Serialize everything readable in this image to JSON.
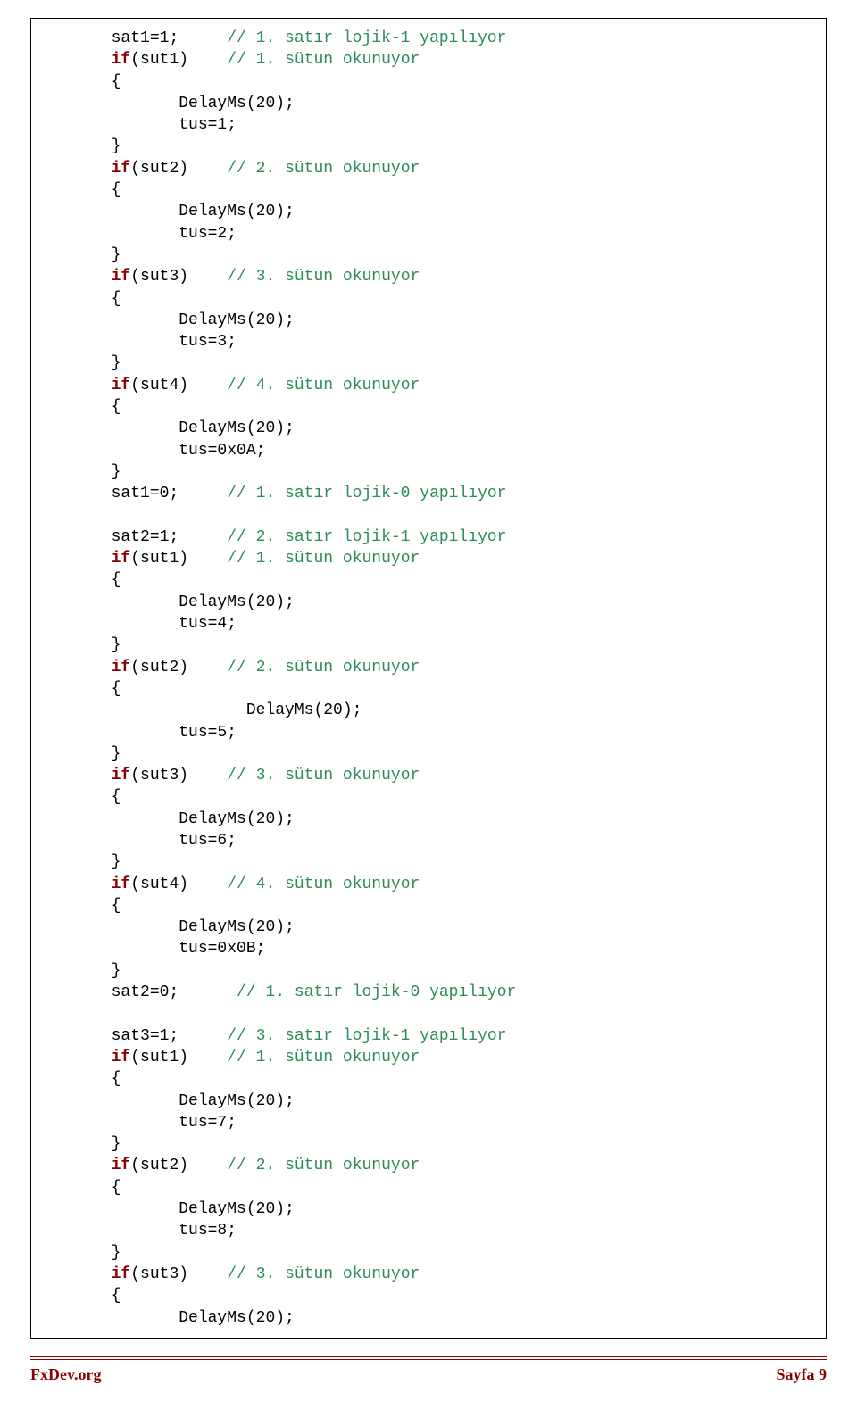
{
  "footer": {
    "site": "FxDev.org",
    "page": "Sayfa 9"
  },
  "c": {
    "l1a": "       sat1=1;     ",
    "l1b": "// 1. satır lojik-1 yapılıyor",
    "l2a": "       ",
    "l2if": "if",
    "l2b": "(sut1)    ",
    "l2c": "// 1. sütun okunuyor",
    "l3": "       {",
    "l4": "              DelayMs(20);",
    "l5": "              tus=1;",
    "l6": "       }",
    "l7a": "       ",
    "l7if": "if",
    "l7b": "(sut2)    ",
    "l7c": "// 2. sütun okunuyor",
    "l8": "       {",
    "l9": "              DelayMs(20);",
    "l10": "              tus=2;",
    "l11": "       }",
    "l12a": "       ",
    "l12if": "if",
    "l12b": "(sut3)    ",
    "l12c": "// 3. sütun okunuyor",
    "l13": "       {",
    "l14": "              DelayMs(20);",
    "l15": "              tus=3;",
    "l16": "       }",
    "l17a": "       ",
    "l17if": "if",
    "l17b": "(sut4)    ",
    "l17c": "// 4. sütun okunuyor",
    "l18": "       {",
    "l19": "              DelayMs(20);",
    "l20": "              tus=0x0A;",
    "l21": "       }",
    "l22a": "       sat1=0;     ",
    "l22b": "// 1. satır lojik-0 yapılıyor",
    "blank1": "",
    "l23a": "       sat2=1;     ",
    "l23b": "// 2. satır lojik-1 yapılıyor",
    "l24a": "       ",
    "l24if": "if",
    "l24b": "(sut1)    ",
    "l24c": "// 1. sütun okunuyor",
    "l25": "       {",
    "l26": "              DelayMs(20);",
    "l27": "              tus=4;",
    "l28": "       }",
    "l29a": "       ",
    "l29if": "if",
    "l29b": "(sut2)    ",
    "l29c": "// 2. sütun okunuyor",
    "l30": "       {",
    "l31": "                     DelayMs(20);",
    "l32": "              tus=5;",
    "l33": "       }",
    "l34a": "       ",
    "l34if": "if",
    "l34b": "(sut3)    ",
    "l34c": "// 3. sütun okunuyor",
    "l35": "       {",
    "l36": "              DelayMs(20);",
    "l37": "              tus=6;",
    "l38": "       }",
    "l39a": "       ",
    "l39if": "if",
    "l39b": "(sut4)    ",
    "l39c": "// 4. sütun okunuyor",
    "l40": "       {",
    "l41": "              DelayMs(20);",
    "l42": "              tus=0x0B;",
    "l43": "       }",
    "l44a": "       sat2=0;      ",
    "l44b": "// 1. satır lojik-0 yapılıyor",
    "blank2": "",
    "l45a": "       sat3=1;     ",
    "l45b": "// 3. satır lojik-1 yapılıyor",
    "l46a": "       ",
    "l46if": "if",
    "l46b": "(sut1)    ",
    "l46c": "// 1. sütun okunuyor",
    "l47": "       {",
    "l48": "              DelayMs(20);",
    "l49": "              tus=7;",
    "l50": "       }",
    "l51a": "       ",
    "l51if": "if",
    "l51b": "(sut2)    ",
    "l51c": "// 2. sütun okunuyor",
    "l52": "       {",
    "l53": "              DelayMs(20);",
    "l54": "              tus=8;",
    "l55": "       }",
    "l56a": "       ",
    "l56if": "if",
    "l56b": "(sut3)    ",
    "l56c": "// 3. sütun okunuyor",
    "l57": "       {",
    "l58": "              DelayMs(20);"
  }
}
